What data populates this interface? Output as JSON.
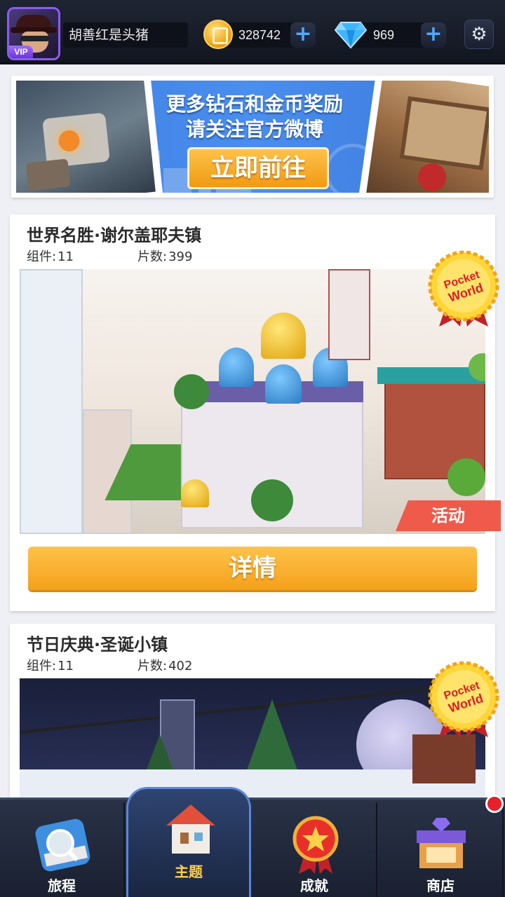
{
  "topbar": {
    "avatar_badge": "VIP",
    "username": "胡善红是头猪",
    "coins": "328742",
    "gems": "969",
    "plus": "+",
    "settings_icon": "gear-icon"
  },
  "banner": {
    "line1": "更多钻石和金币奖励",
    "line2": "请关注官方微博",
    "button": "立即前往"
  },
  "cards": [
    {
      "title": "世界名胜·谢尔盖耶夫镇",
      "parts_label": "组件:",
      "parts": "11",
      "pieces_label": "片数:",
      "pieces": "399",
      "badge": "Pocket World",
      "tag": "活动",
      "button": "详情"
    },
    {
      "title": "节日庆典·圣诞小镇",
      "parts_label": "组件:",
      "parts": "11",
      "pieces_label": "片数:",
      "pieces": "402",
      "badge": "Pocket World"
    }
  ],
  "nav": {
    "items": [
      {
        "label": "旅程",
        "icon": "camera-icon"
      },
      {
        "label": "主题",
        "icon": "house-icon"
      },
      {
        "label": "成就",
        "icon": "medal-icon"
      },
      {
        "label": "商店",
        "icon": "shop-icon"
      }
    ],
    "active_index": 1
  },
  "colors": {
    "accent_orange": "#f3a11a",
    "tag_red": "#ef5a4a",
    "active_label": "#ffd24a"
  }
}
